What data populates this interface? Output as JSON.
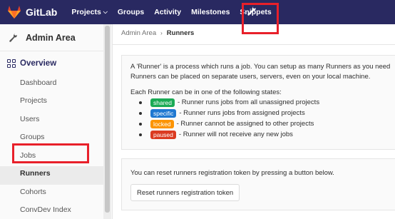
{
  "navbar": {
    "brand": "GitLab",
    "items": [
      {
        "label": "Projects",
        "has_caret": true
      },
      {
        "label": "Groups"
      },
      {
        "label": "Activity"
      },
      {
        "label": "Milestones"
      },
      {
        "label": "Snippets"
      }
    ],
    "admin_icon": "wrench-icon",
    "colors": {
      "background": "#292961",
      "logo": "#e24329",
      "highlight": "#e8202a"
    }
  },
  "sidebar": {
    "title": "Admin Area",
    "overview": "Overview",
    "items": [
      {
        "label": "Dashboard"
      },
      {
        "label": "Projects"
      },
      {
        "label": "Users"
      },
      {
        "label": "Groups"
      },
      {
        "label": "Jobs"
      },
      {
        "label": "Runners",
        "active": true
      },
      {
        "label": "Cohorts"
      },
      {
        "label": "ConvDev Index"
      }
    ]
  },
  "breadcrumb": {
    "parent": "Admin Area",
    "separator": "›",
    "current": "Runners"
  },
  "info_panel": {
    "line1": "A 'Runner' is a process which runs a job. You can setup as many Runners as you need",
    "line2": "Runners can be placed on separate users, servers, even on your local machine.",
    "states_intro": "Each Runner can be in one of the following states:",
    "states": [
      {
        "badge": "shared",
        "color": "#1aaa55",
        "desc": "- Runner runs jobs from all unassigned projects"
      },
      {
        "badge": "specific",
        "color": "#1f78d1",
        "desc": "- Runner runs jobs from assigned projects"
      },
      {
        "badge": "locked",
        "color": "#fc9403",
        "desc": "- Runner cannot be assigned to other projects"
      },
      {
        "badge": "paused",
        "color": "#db3b21",
        "desc": "- Runner will not receive any new jobs"
      }
    ]
  },
  "token_panel": {
    "text": "You can reset runners registration token by pressing a button below.",
    "button": "Reset runners registration token"
  }
}
